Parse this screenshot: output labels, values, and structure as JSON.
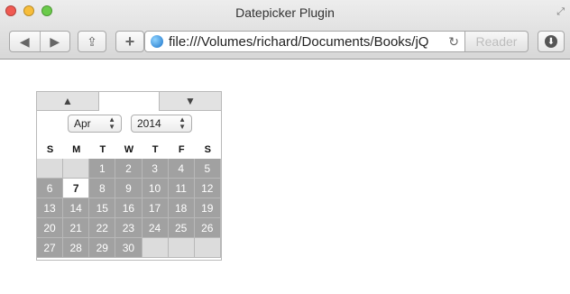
{
  "window": {
    "title": "Datepicker Plugin"
  },
  "toolbar": {
    "address_url": "file:///Volumes/richard/Documents/Books/jQ",
    "reader_label": "Reader"
  },
  "datepicker": {
    "month": "Apr",
    "year": "2014",
    "weekdays": [
      "S",
      "M",
      "T",
      "W",
      "T",
      "F",
      "S"
    ],
    "weeks": [
      [
        null,
        null,
        "1",
        "2",
        "3",
        "4",
        "5"
      ],
      [
        "6",
        "7",
        "8",
        "9",
        "10",
        "11",
        "12"
      ],
      [
        "13",
        "14",
        "15",
        "16",
        "17",
        "18",
        "19"
      ],
      [
        "20",
        "21",
        "22",
        "23",
        "24",
        "25",
        "26"
      ],
      [
        "27",
        "28",
        "29",
        "30",
        null,
        null,
        null
      ]
    ],
    "selected_day": "7"
  }
}
